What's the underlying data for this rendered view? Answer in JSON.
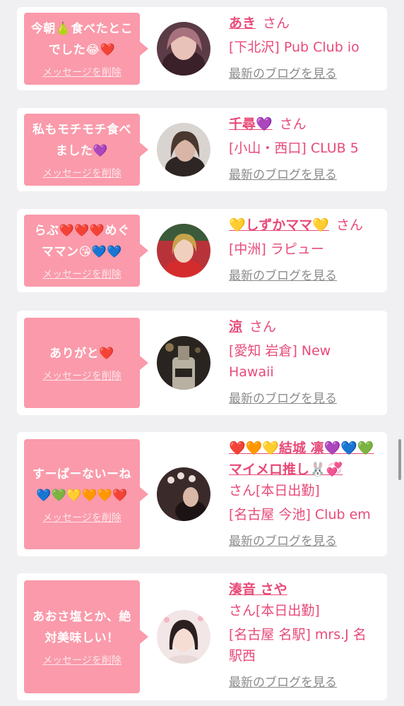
{
  "accent_color": "#e84a78",
  "bubble_color": "#fa9aaa",
  "delete_label": "メッセージを削除",
  "blog_label": "最新のブログを見る",
  "san_label": "さん",
  "cards": [
    {
      "message": "今朝🍐食べたとこでした😂❤️",
      "name": "あき",
      "shop": "[下北沢] Pub Club io",
      "avatar_icon": "woman-portrait"
    },
    {
      "message": "私もモチモチ食べました💜",
      "name": "千尋💜",
      "shop": "[小山・西口] CLUB 5",
      "avatar_icon": "woman-portrait"
    },
    {
      "message": "らぶ❤️❤️❤️めぐママン😘💙💙",
      "name": "💛しずかママ💛",
      "shop": "[中洲] ラピュー",
      "avatar_icon": "woman-portrait"
    },
    {
      "message": "ありがと❤️",
      "name": "涼",
      "shop": "[愛知 岩倉] New Hawaii",
      "avatar_icon": "champagne-bottle"
    },
    {
      "message": "すーぱーないーね💙💚💛🧡🧡❤️",
      "name": "❤️🧡💛結城 凛💜💙💚マイメロ推し🐰💞",
      "san_suffix": "さん[本日出勤]",
      "shop": "[名古屋 今池] Club em",
      "avatar_icon": "woman-portrait"
    },
    {
      "message": "あおさ塩とか、絶対美味しい！",
      "name": "湊音 さや",
      "san_suffix": "さん[本日出勤]",
      "shop": "[名古屋 名駅] mrs.J 名駅西",
      "avatar_icon": "woman-portrait"
    }
  ]
}
